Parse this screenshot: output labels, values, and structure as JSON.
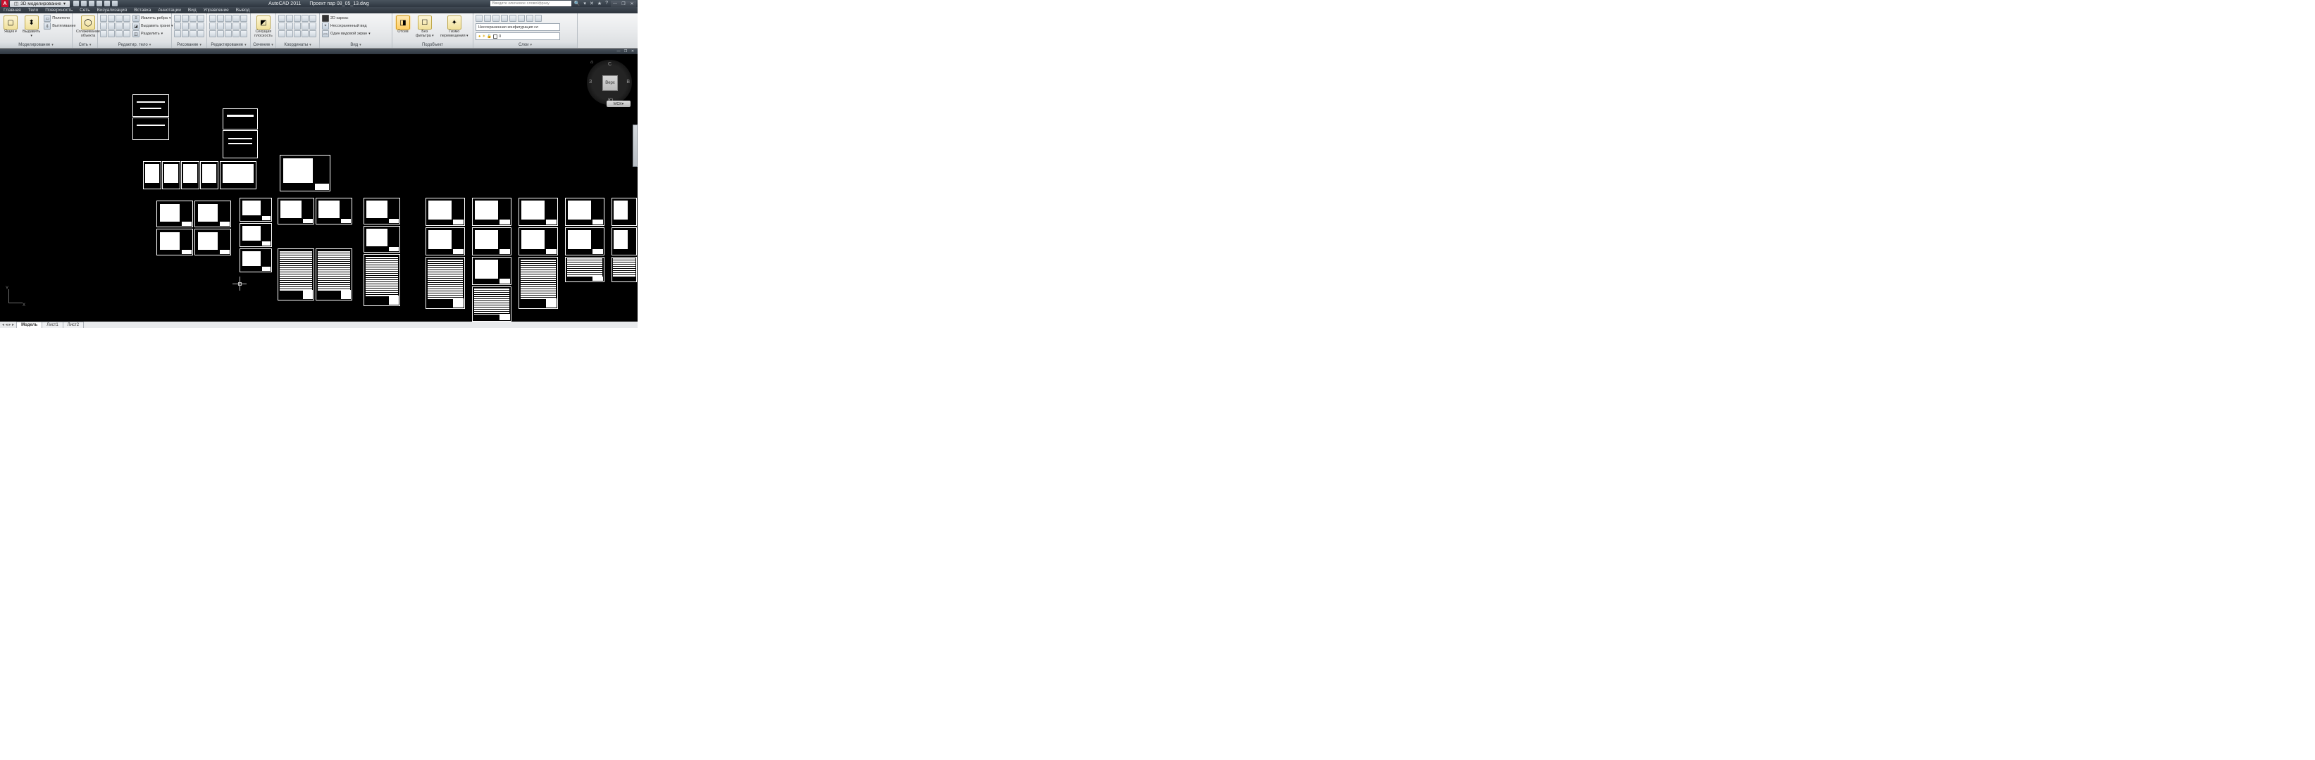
{
  "title": {
    "app": "AutoCAD 2011",
    "document": "Проект пар 08_05_13.dwg",
    "workspace": "3D моделирование",
    "search_placeholder": "Введите ключевое слово/фразу"
  },
  "window_controls": {
    "min": "—",
    "max": "❐",
    "close": "✕"
  },
  "menu": [
    "Главная",
    "Тело",
    "Поверхность",
    "Сеть",
    "Визуализация",
    "Вставка",
    "Аннотации",
    "Вид",
    "Управление",
    "Вывод"
  ],
  "ribbon": {
    "panel_modeling": {
      "title": "Моделирование",
      "big1": "Ящик",
      "big2": "Выдавить",
      "small1": "Политело",
      "small2": "Вытягивание",
      "smooth": "Сглаживание\nобъекта"
    },
    "panel_net": {
      "title": "Сеть"
    },
    "panel_edit_body": {
      "title": "Редактир. тело",
      "s1": "Извлечь ребра",
      "s2": "Выдавить грани",
      "s3": "Разделить"
    },
    "panel_draw": {
      "title": "Рисование"
    },
    "panel_modify": {
      "title": "Редактирование"
    },
    "panel_section": {
      "title": "Сечение",
      "big": "Секущая\nплоскость"
    },
    "panel_coords": {
      "title": "Координаты"
    },
    "panel_view": {
      "title": "Вид",
      "s1": "2D каркас",
      "s2": "Несохраненный вид",
      "s3": "Один видовой экран"
    },
    "panel_subobject": {
      "title": "Подобъект",
      "big1": "Отсев",
      "big2": "Без фильтра",
      "big3": "Гизмо перемещения"
    },
    "panel_layers": {
      "title": "Слои",
      "combo": "Несохраненная конфигурация сл",
      "current": "0"
    }
  },
  "viewcube": {
    "face": "Верх",
    "n": "С",
    "s": "Ю",
    "e": "В",
    "w": "З",
    "wcs": "МСК"
  },
  "ucs": {
    "x": "X",
    "y": "Y"
  },
  "layout_tabs": {
    "nav": "◂ ◂ ▸ ▸",
    "model": "Модель",
    "l1": "Лист1",
    "l2": "Лист2"
  }
}
